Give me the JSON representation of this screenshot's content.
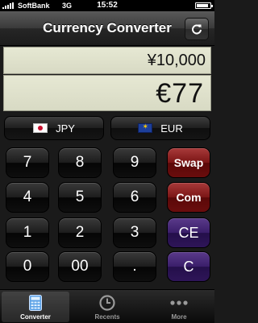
{
  "status_bar": {
    "carrier": "SoftBank",
    "network": "3G",
    "time": "15:52"
  },
  "nav": {
    "title": "Currency Converter",
    "refresh_icon": "refresh-icon"
  },
  "display": {
    "source_value": "¥10,000",
    "converted_value": "€77"
  },
  "currencies": {
    "from": {
      "code": "JPY",
      "flag": "japan-flag-icon"
    },
    "to": {
      "code": "EUR",
      "flag": "eu-flag-icon"
    }
  },
  "keypad": {
    "k7": "7",
    "k8": "8",
    "k9": "9",
    "swap": "Swap",
    "k4": "4",
    "k5": "5",
    "k6": "6",
    "com": "Com",
    "k1": "1",
    "k2": "2",
    "k3": "3",
    "ce": "CE",
    "k0": "0",
    "k00": "00",
    "dot": ".",
    "clear": "C"
  },
  "tabs": [
    {
      "label": "Converter",
      "icon": "calculator-icon",
      "active": true
    },
    {
      "label": "Recents",
      "icon": "clock-icon",
      "active": false
    },
    {
      "label": "More",
      "icon": "more-dots-icon",
      "active": false
    }
  ],
  "colors": {
    "display_bg": "#e2e4cf",
    "swap_com_key": "#7a1515",
    "ce_c_key": "#3a1e6a"
  }
}
